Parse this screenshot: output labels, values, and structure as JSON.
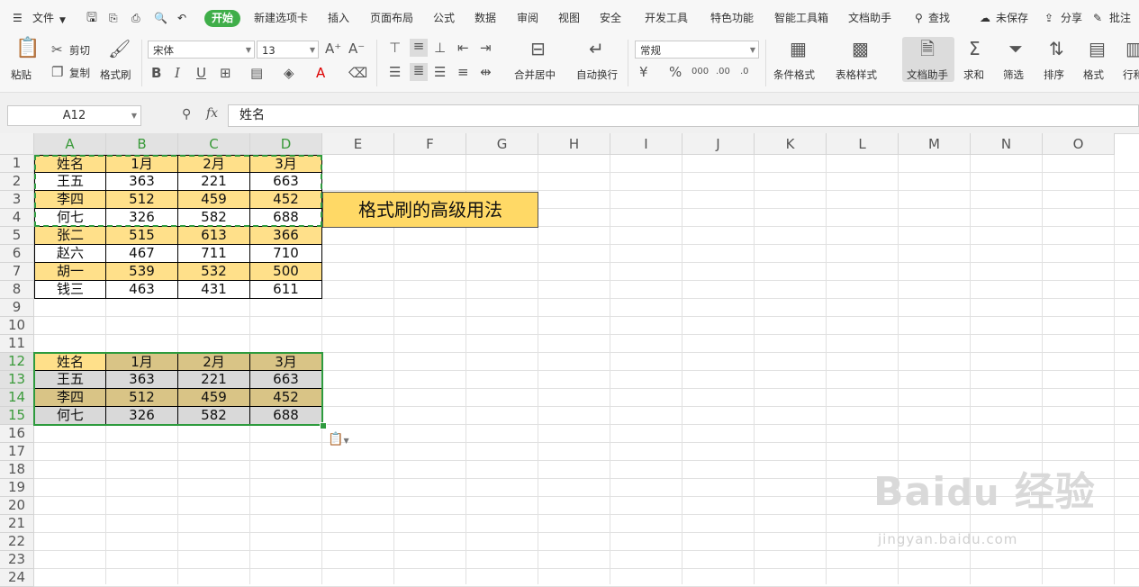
{
  "menubar": {
    "file_label": "文件",
    "tabs": [
      "开始",
      "新建选项卡",
      "插入",
      "页面布局",
      "公式",
      "数据",
      "审阅",
      "视图",
      "安全",
      "开发工具",
      "特色功能",
      "智能工具箱",
      "文档助手",
      "查找"
    ],
    "active_tab": "开始",
    "unsaved_label": "未保存",
    "share_label": "分享",
    "annotate_label": "批注"
  },
  "ribbon": {
    "paste_label": "粘贴",
    "cut_label": "剪切",
    "copy_label": "复制",
    "format_painter_label": "格式刷",
    "font_name": "宋体",
    "font_size": "13",
    "merge_label": "合并居中",
    "wrap_label": "自动换行",
    "number_format": "常规",
    "cond_format_label": "条件格式",
    "table_style_label": "表格样式",
    "doc_assistant_label": "文档助手",
    "sum_label": "求和",
    "filter_label": "筛选",
    "sort_label": "排序",
    "format_label": "格式",
    "rowcol_label": "行和"
  },
  "formula_bar": {
    "name_box": "A12",
    "fx_label": "fx",
    "content": "姓名"
  },
  "columns": [
    "A",
    "B",
    "C",
    "D",
    "E",
    "F",
    "G",
    "H",
    "I",
    "J",
    "K",
    "L",
    "M",
    "N",
    "O"
  ],
  "rows": [
    "1",
    "2",
    "3",
    "4",
    "5",
    "6",
    "7",
    "8",
    "9",
    "10",
    "11",
    "12",
    "13",
    "14",
    "15",
    "16",
    "17",
    "18",
    "19",
    "20",
    "21",
    "22",
    "23",
    "24"
  ],
  "table1": [
    [
      "姓名",
      "1月",
      "2月",
      "3月"
    ],
    [
      "王五",
      "363",
      "221",
      "663"
    ],
    [
      "李四",
      "512",
      "459",
      "452"
    ],
    [
      "何七",
      "326",
      "582",
      "688"
    ],
    [
      "张二",
      "515",
      "613",
      "366"
    ],
    [
      "赵六",
      "467",
      "711",
      "710"
    ],
    [
      "胡一",
      "539",
      "532",
      "500"
    ],
    [
      "钱三",
      "463",
      "431",
      "611"
    ]
  ],
  "table2": [
    [
      "姓名",
      "1月",
      "2月",
      "3月"
    ],
    [
      "王五",
      "363",
      "221",
      "663"
    ],
    [
      "李四",
      "512",
      "459",
      "452"
    ],
    [
      "何七",
      "326",
      "582",
      "688"
    ]
  ],
  "note_text": "格式刷的高级用法",
  "watermark": {
    "brand": "Baidu 经验",
    "url": "jingyan.baidu.com"
  },
  "colors": {
    "accent": "#3fae49",
    "yellow_row": "#ffe08a",
    "tan_cell": "#d9c486",
    "gray_cell": "#d9d9d9",
    "note_bg": "#ffd966"
  }
}
